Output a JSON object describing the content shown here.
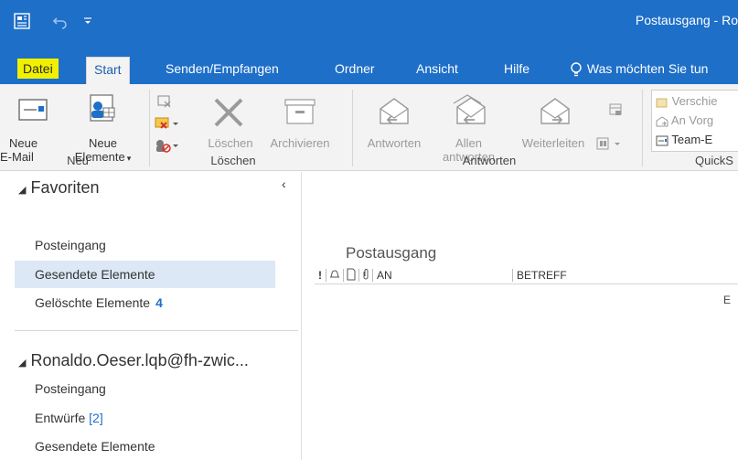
{
  "titlebar": {
    "title": "Postausgang - Ro",
    "qat_icons": [
      "outlook-app-icon",
      "undo-icon",
      "customize-qat-icon"
    ]
  },
  "tabs": {
    "datei": "Datei",
    "start": "Start",
    "senden": "Senden/Empfangen",
    "ordner": "Ordner",
    "ansicht": "Ansicht",
    "hilfe": "Hilfe",
    "tellme": "Was möchten Sie tun"
  },
  "ribbon": {
    "neu": {
      "neue_email_1": "Neue",
      "neue_email_2": "E-Mail",
      "neue_elemente_1": "Neue",
      "neue_elemente_2": "Elemente",
      "group": "Neu"
    },
    "loeschen": {
      "loeschen": "Löschen",
      "archivieren": "Archivieren",
      "group": "Löschen"
    },
    "antworten": {
      "antworten": "Antworten",
      "allen_1": "Allen",
      "allen_2": "antworten",
      "weiterleiten": "Weiterleiten",
      "group": "Antworten"
    },
    "quicksteps": {
      "item1": "Verschie",
      "item2": "An Vorg",
      "item3": "Team-E",
      "group": "QuickS"
    }
  },
  "nav": {
    "favoriten": "Favoriten",
    "fav_items": [
      {
        "label": "Posteingang"
      },
      {
        "label": "Gesendete Elemente"
      },
      {
        "label": "Gelöschte Elemente",
        "count": "4"
      }
    ],
    "account": "Ronaldo.Oeser.lqb@fh-zwic...",
    "account_items": [
      {
        "label": "Posteingang"
      },
      {
        "label": "Entwürfe",
        "count": "[2]"
      },
      {
        "label": "Gesendete Elemente"
      }
    ]
  },
  "content": {
    "folder_title": "Postausgang",
    "columns": {
      "importance": "!",
      "an": "AN",
      "betreff": "BETREFF"
    },
    "truncated_text": "E"
  },
  "colors": {
    "accent": "#1E6FC8",
    "datei_highlight": "#F0F000",
    "selected": "#DCE8F5"
  }
}
